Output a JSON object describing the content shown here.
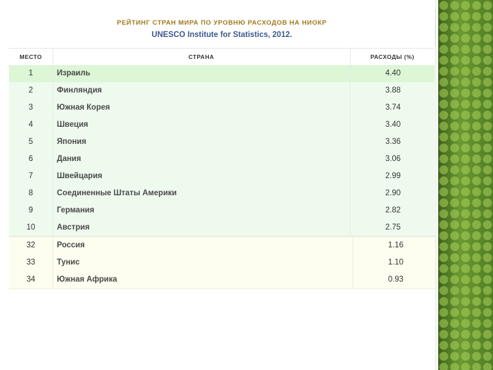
{
  "title_line1": "РЕЙТИНГ СТРАН МИРА ПО УРОВНЮ РАСХОДОВ НА НИОКР",
  "title_line2": "UNESCO Institute for Statistics, 2012.",
  "columns": {
    "rank": "МЕСТО",
    "country": "СТРАНА",
    "spend": "РАСХОДЫ (%)"
  },
  "rows": [
    {
      "rank": "1",
      "country": "Израиль",
      "value": "4.40"
    },
    {
      "rank": "2",
      "country": "Финляндия",
      "value": "3.88"
    },
    {
      "rank": "3",
      "country": "Южная Корея",
      "value": "3.74"
    },
    {
      "rank": "4",
      "country": "Швеция",
      "value": "3.40"
    },
    {
      "rank": "5",
      "country": "Япония",
      "value": "3.36"
    },
    {
      "rank": "6",
      "country": "Дания",
      "value": "3.06"
    },
    {
      "rank": "7",
      "country": "Швейцария",
      "value": "2.99"
    },
    {
      "rank": "8",
      "country": "Соединенные Штаты Америки",
      "value": "2.90"
    },
    {
      "rank": "9",
      "country": "Германия",
      "value": "2.82"
    },
    {
      "rank": "10",
      "country": "Австрия",
      "value": "2.75"
    },
    {
      "rank": "32",
      "country": "Россия",
      "value": "1.16"
    },
    {
      "rank": "33",
      "country": "Тунис",
      "value": "1.10"
    },
    {
      "rank": "34",
      "country": "Южная Африка",
      "value": "0.93"
    }
  ],
  "colors": {
    "title_gold": "#a07a1c",
    "title_blue": "#3b5b8a",
    "row_green": "#effaef",
    "row_highlight": "#dcf6d6",
    "row_cream": "#fdfdf0",
    "side_band": "#5c8a2a"
  }
}
